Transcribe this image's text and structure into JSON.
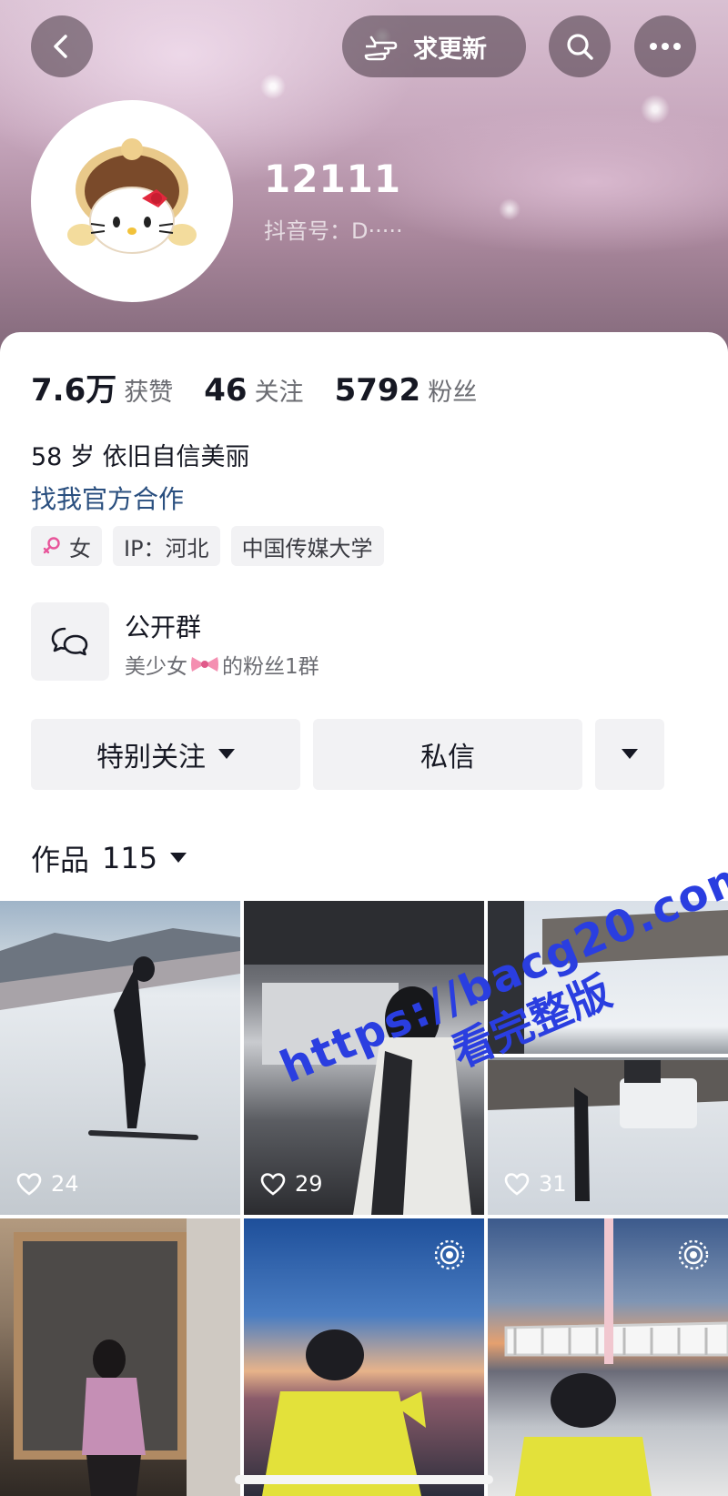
{
  "header": {
    "update_label": "求更新",
    "nickname": "12111",
    "douyin_id": "抖音号：D·····",
    "icons": {
      "back": "back-chevron-icon",
      "update": "pointing-hand-icon",
      "search": "search-icon",
      "more": "more-dots-icon"
    }
  },
  "stats": [
    {
      "value": "7.6万",
      "label": "获赞"
    },
    {
      "value": "46",
      "label": "关注"
    },
    {
      "value": "5792",
      "label": "粉丝"
    }
  ],
  "bio": {
    "text": "58 岁 依旧自信美丽",
    "business_link": "找我官方合作"
  },
  "tags": {
    "gender": "女",
    "ip": "IP：河北",
    "school": "中国传媒大学"
  },
  "group": {
    "title": "公开群",
    "subtitle_prefix": "美少女",
    "subtitle_suffix": "的粉丝1群"
  },
  "actions": {
    "follow": "特别关注",
    "message": "私信"
  },
  "works": {
    "label": "作品",
    "count": "115"
  },
  "grid": {
    "likes": [
      "24",
      "29",
      "31"
    ]
  },
  "watermark": {
    "url": "https://bacg20.com",
    "cn": "看完整版"
  },
  "colors": {
    "link": "#2a4f7f",
    "chip_bg": "#f2f2f4",
    "watermark": "#2a3ee0"
  }
}
